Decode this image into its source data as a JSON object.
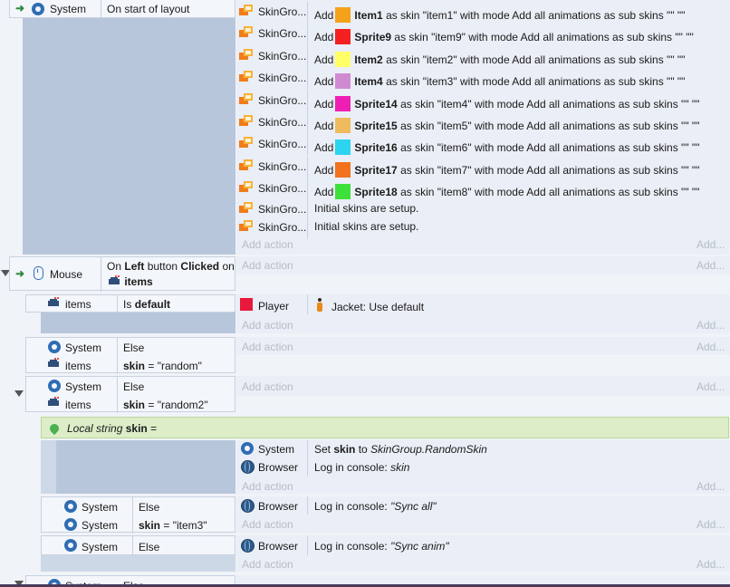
{
  "common": {
    "system": "System",
    "mouse": "Mouse",
    "items": "items",
    "player": "Player",
    "browser": "Browser",
    "skingroup_short": "SkinGro...",
    "add_action": "Add action",
    "add_more": "Add..."
  },
  "event1": {
    "trigger": "On start of layout",
    "actions": [
      {
        "sprite": "Item1",
        "text": "as skin \"item1\" with mode Add all animations as sub skins \"\" \"\"",
        "color": "#f5a21b"
      },
      {
        "sprite": "Sprite9",
        "text": "as skin \"item9\" with mode Add all animations as sub skins \"\" \"\"",
        "color": "#f52121"
      },
      {
        "sprite": "Item2",
        "text": "as skin \"item2\" with mode Add all animations as sub skins \"\" \"\"",
        "color": "#ffff66"
      },
      {
        "sprite": "Item4",
        "text": "as skin \"item3\" with mode Add all animations as sub skins \"\" \"\"",
        "color": "#d08ad2"
      },
      {
        "sprite": "Sprite14",
        "text": "as skin \"item4\" with mode Add all animations as sub skins \"\" \"\"",
        "color": "#f01fb4"
      },
      {
        "sprite": "Sprite15",
        "text": "as skin \"item5\" with mode Add all animations as sub skins \"\" \"\"",
        "color": "#eebc5e"
      },
      {
        "sprite": "Sprite16",
        "text": "as skin \"item6\" with mode Add all animations as sub skins \"\" \"\"",
        "color": "#2cd4ef"
      },
      {
        "sprite": "Sprite17",
        "text": "as skin \"item7\" with mode Add all animations as sub skins \"\" \"\"",
        "color": "#f2721e"
      },
      {
        "sprite": "Sprite18",
        "text": "as skin \"item8\" with mode Add all animations as sub skins \"\" \"\"",
        "color": "#3ee03a"
      }
    ],
    "add_word": "Add",
    "setup_text": "Initial skins are setup."
  },
  "event2": {
    "on": "On",
    "left": "Left",
    "button": "button",
    "clicked": "Clicked",
    "on2": "on"
  },
  "sub1": {
    "cond": "Is",
    "cond_bold": "default",
    "action_text": "Jacket: Use default",
    "player_color": "#e8193c"
  },
  "sub2": {
    "else": "Else",
    "skin": "skin",
    "value": "= \"random\""
  },
  "sub3": {
    "else": "Else",
    "skin": "skin",
    "value": "= \"random2\""
  },
  "local": {
    "label": "Local string",
    "name": "skin",
    "eq": "="
  },
  "sub3a": {
    "set": "Set",
    "skin": "skin",
    "to": "to",
    "expr": "SkinGroup.RandomSkin",
    "log": "Log in console:",
    "log_val": "skin"
  },
  "sub4": {
    "else": "Else",
    "skin": "skin",
    "value": "= \"item3\"",
    "log": "Log in console:",
    "log_val": "\"Sync all\""
  },
  "sub5": {
    "else": "Else",
    "log": "Log in console:",
    "log_val": "\"Sync anim\""
  },
  "partial": {
    "system": "System",
    "else": "Else"
  }
}
